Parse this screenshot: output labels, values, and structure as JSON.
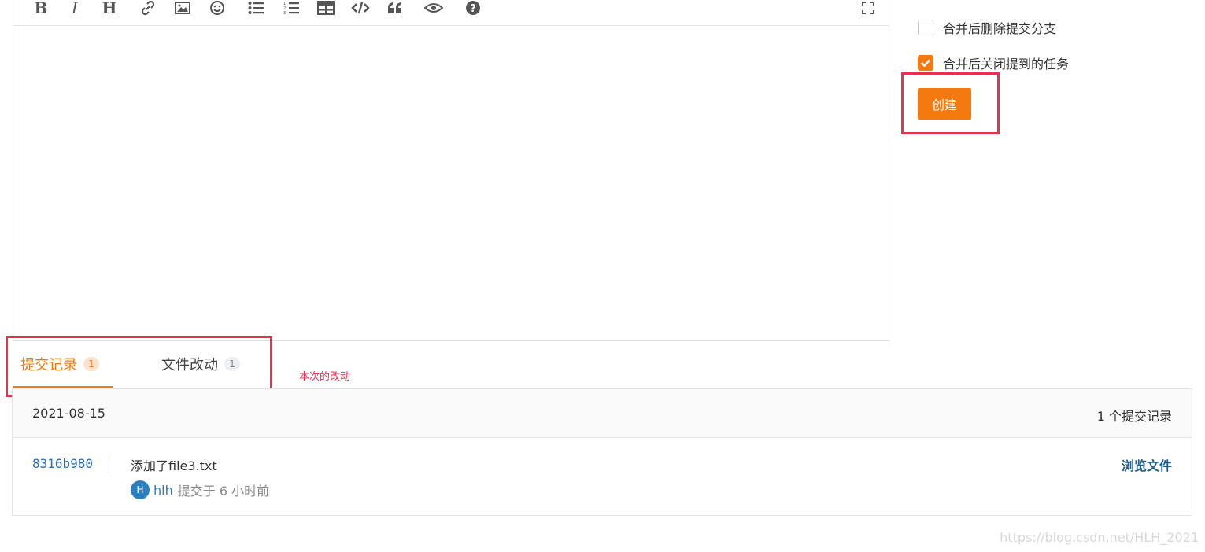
{
  "toolbar": {
    "bold": "B",
    "italic": "I",
    "heading": "H",
    "icons": [
      "bold-icon",
      "italic-icon",
      "heading-icon",
      "link-icon",
      "image-icon",
      "emoji-icon",
      "bullet-list-icon",
      "numbered-list-icon",
      "table-icon",
      "code-icon",
      "quote-icon",
      "preview-eye-icon",
      "help-icon",
      "fullscreen-icon"
    ]
  },
  "options": {
    "delete_branch_label": "合并后删除提交分支",
    "delete_branch_checked": false,
    "close_issues_label": "合并后关闭提到的任务",
    "close_issues_checked": true
  },
  "create_button_label": "创建",
  "tabs": [
    {
      "label": "提交记录",
      "count": "1",
      "active": true
    },
    {
      "label": "文件改动",
      "count": "1",
      "active": false
    }
  ],
  "annotation_text": "本次的改动",
  "commits": {
    "date": "2021-08-15",
    "count_label": "1 个提交记录",
    "items": [
      {
        "sha": "8316b980",
        "message": "添加了file3.txt",
        "avatar_initial": "H",
        "author": "hlh",
        "time_text": "提交于 6 小时前",
        "browse_label": "浏览文件"
      }
    ]
  },
  "watermark": "https://blog.csdn.net/HLH_2021",
  "colors": {
    "accent": "#f47a10",
    "annotation": "#e8304f",
    "link": "#2b6db0"
  }
}
